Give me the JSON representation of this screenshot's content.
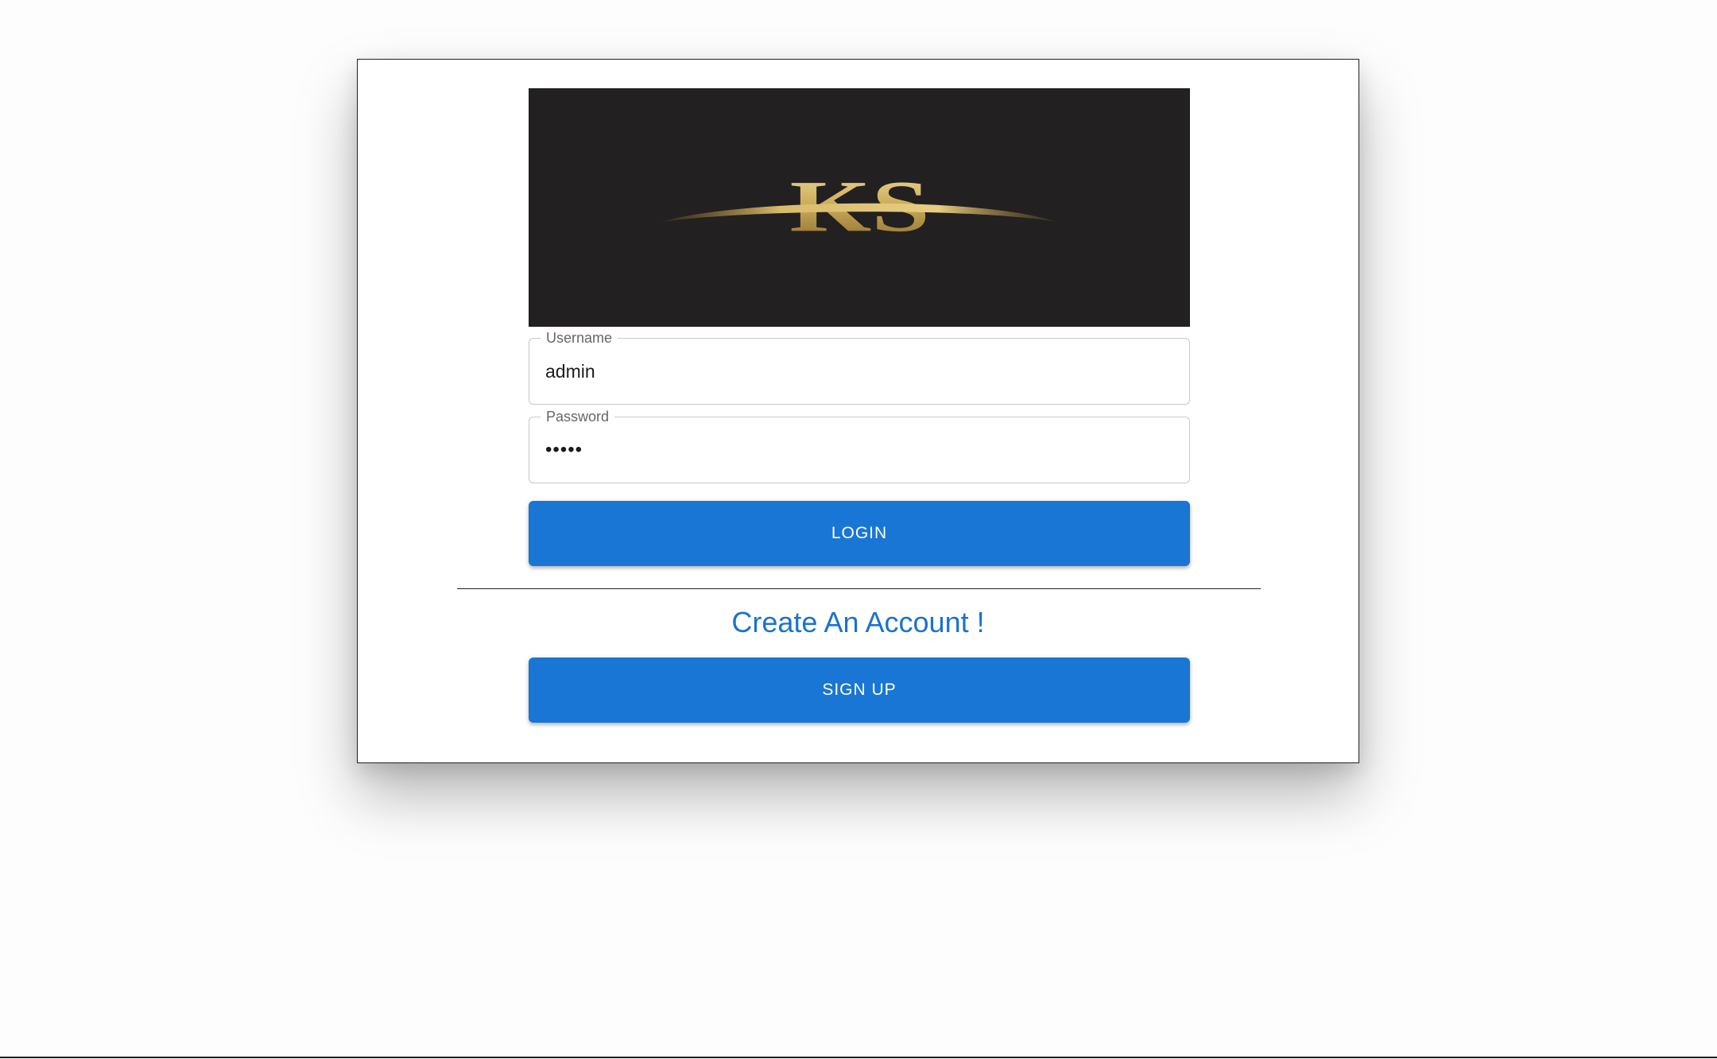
{
  "logo": {
    "text": "KS",
    "background": "#232021"
  },
  "login_form": {
    "username": {
      "label": "Username",
      "value": "admin"
    },
    "password": {
      "label": "Password",
      "value": "•••••"
    },
    "login_button": "LOGIN",
    "create_account_text": "Create An Account !",
    "signup_button": "SIGN UP"
  },
  "colors": {
    "primary_button": "#1976d4",
    "link_text": "#1b72cc"
  }
}
